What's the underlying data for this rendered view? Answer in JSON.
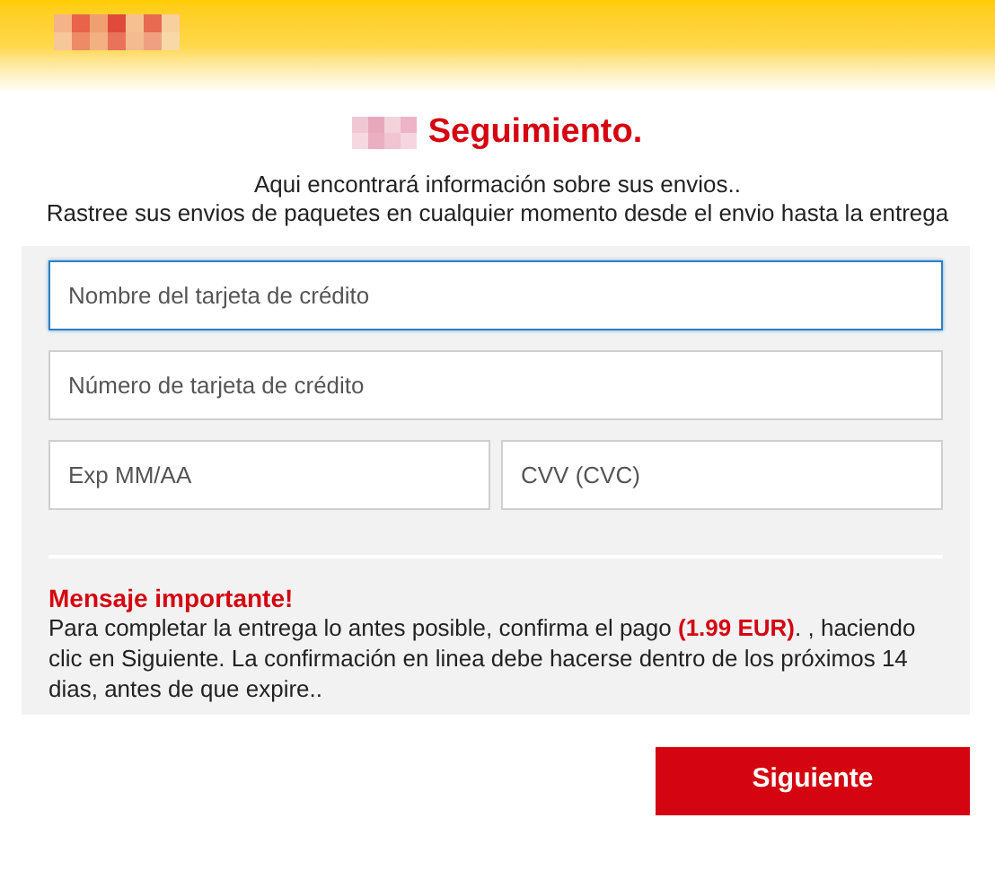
{
  "header": {
    "title": "Seguimiento.",
    "lines": [
      "Aqui encontrará información sobre sus envios..",
      "Rastree sus envios de paquetes en cualquier momento desde el envio hasta la entrega"
    ]
  },
  "form": {
    "fields": [
      {
        "placeholder": "Nombre del tarjeta de crédito",
        "focused": true
      },
      {
        "placeholder": "Número de tarjeta de crédito",
        "focused": false
      }
    ],
    "row": [
      {
        "placeholder": "Exp MM/AA",
        "focused": false
      },
      {
        "placeholder": "CVV (CVC)",
        "focused": false
      }
    ],
    "notice": {
      "title": "Mensaje importante!",
      "text": "Para completar la entrega lo antes posible, confirma el pago **(1.99 EUR)**. , haciendo clic en Siguiente. La confirmación en linea debe hacerse dentro de los próximos 14 dias, antes de que expire.."
    }
  },
  "button": "Siguiente"
}
